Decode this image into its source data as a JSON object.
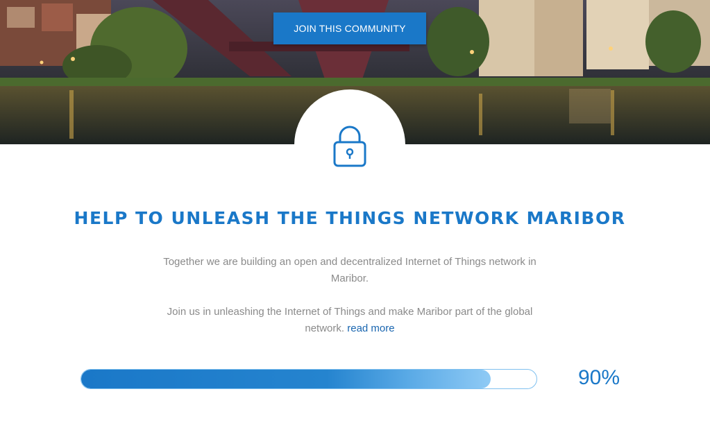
{
  "hero": {
    "join_button_label": "JOIN THIS COMMUNITY"
  },
  "lock": {
    "icon": "lock-icon"
  },
  "headline": "HELP TO UNLEASH THE THINGS NETWORK MARIBOR",
  "paragraphs": {
    "p1": "Together we are building an open and decentralized Internet of Things network in Maribor.",
    "p2_text": "Join us in unleashing the Internet of Things and make Maribor part of the global network. ",
    "read_more": "read more"
  },
  "progress": {
    "value": 90,
    "label": "90%"
  },
  "colors": {
    "accent": "#1a78c8",
    "text_gray": "#8a8a8a"
  }
}
